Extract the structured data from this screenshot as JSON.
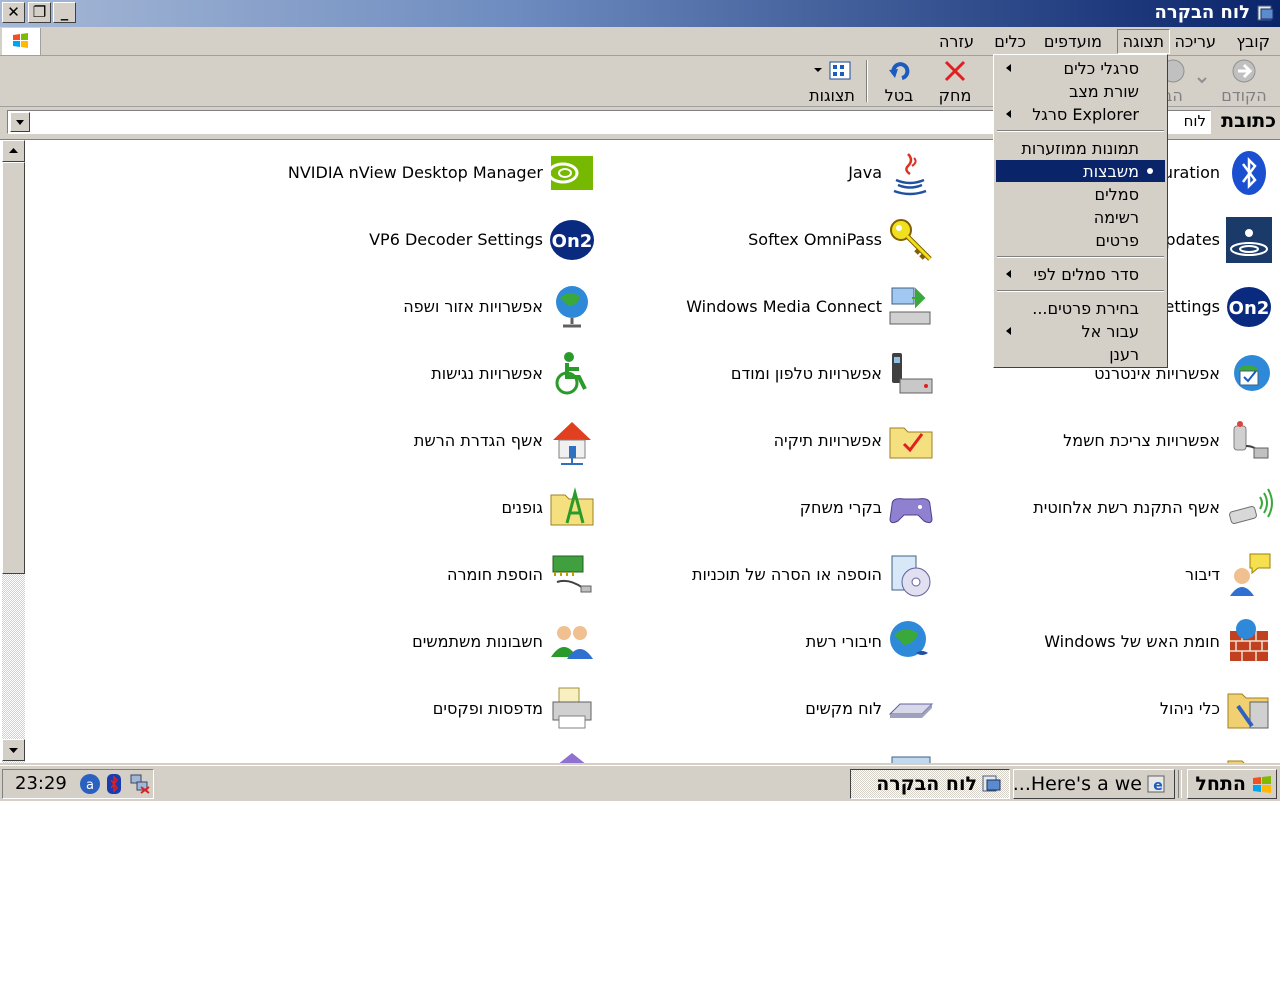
{
  "window": {
    "title": "לוח הבקרה"
  },
  "caption_buttons": {
    "close": "✕",
    "restore": "❐",
    "minimize": "_"
  },
  "menubar": {
    "file": "קובץ",
    "edit": "עריכה",
    "view": "תצוגה",
    "favorites": "מועדפים",
    "tools": "כלים",
    "help": "עזרה"
  },
  "toolbar": {
    "back": "הקודם",
    "forward": "הב",
    "delete": "מחק",
    "undo": "בטל",
    "views": "תצוגות"
  },
  "address": {
    "label": "כתובת",
    "value": "לוח"
  },
  "view_menu": {
    "toolbars": "סרגלי כלים",
    "status_bar": "שורת מצב",
    "explorer_bar": "Explorer סרגל",
    "thumbnails": "תמונות ממוזערות",
    "tiles": "משבצות",
    "icons": "סמלים",
    "list": "רשימה",
    "details": "פרטים",
    "arrange_icons": "סדר סמלים לפי",
    "choose_details": "בחירת פרטים...",
    "go_to": "עבור אל",
    "refresh": "רענן"
  },
  "items": {
    "r1c1": "uration",
    "r1c2": "Java",
    "r1c3": "NVIDIA nView Desktop Manager",
    "r2c1": "Updates",
    "r2c2": "Softex OmniPass",
    "r2c3": "VP6 Decoder Settings",
    "r3c1": "Settings",
    "r3c2": "Windows Media Connect",
    "r3c3": "אפשרויות אזור ושפה",
    "r4c1": "אפשרויות אינטרנט",
    "r4c2": "אפשרויות טלפון ומודם",
    "r4c3": "אפשרויות נגישות",
    "r5c1": "אפשרויות צריכת חשמל",
    "r5c2": "אפשרויות תיקיה",
    "r5c3": "אשף הגדרת הרשת",
    "r6c1": "אשף התקנת רשת אלחוטית",
    "r6c2": "בקרי משחק",
    "r6c3": "גופנים",
    "r7c1": "דיבור",
    "r7c2": "הוספה או הסרה של תוכניות",
    "r7c3": "הוספת חומרה",
    "r8c1": "חומת האש של Windows",
    "r8c2": "חיבורי רשת",
    "r8c3": "חשבונות משתמשים",
    "r9c1": "כלי ניהול",
    "r9c2": "לוח מקשים",
    "r9c3": "מדפסות ופקסים"
  },
  "taskbar": {
    "start": "התחל",
    "task_active": "לוח הבקרה",
    "task_ie": "Here's a we...",
    "clock": "23:29"
  }
}
